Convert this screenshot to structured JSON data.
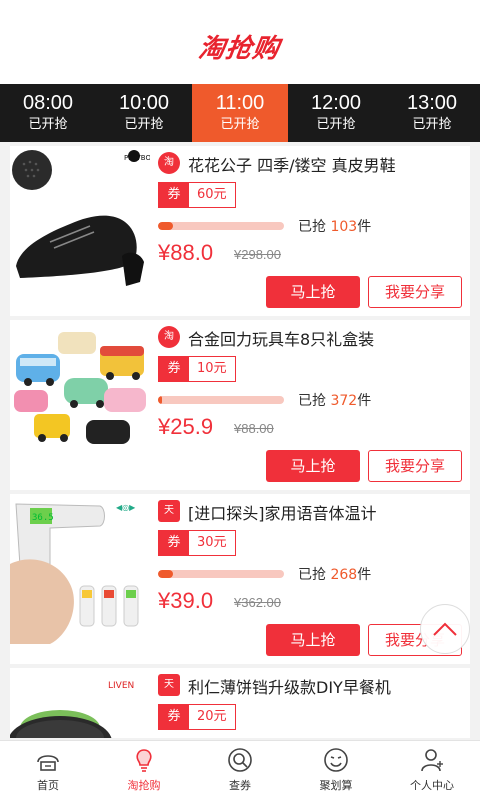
{
  "header": {
    "logo_text": "淘抢购"
  },
  "time_slots": [
    {
      "time": "08:00",
      "status": "已开抢",
      "active": false
    },
    {
      "time": "10:00",
      "status": "已开抢",
      "active": false
    },
    {
      "time": "11:00",
      "status": "已开抢",
      "active": true
    },
    {
      "time": "12:00",
      "status": "已开抢",
      "active": false
    },
    {
      "time": "13:00",
      "status": "已开抢",
      "active": false
    }
  ],
  "products": [
    {
      "source_icon": "taobao-icon",
      "title": "花花公子 四季/镂空 真皮男鞋",
      "coupon_label": "券",
      "coupon_value": "60元",
      "progress": 0.12,
      "sold_label": "已抢",
      "sold_count": "103",
      "sold_unit": "件",
      "price": "¥88.0",
      "original_price": "¥298.00",
      "buy_label": "马上抢",
      "share_label": "我要分享"
    },
    {
      "source_icon": "taobao-icon",
      "title": "合金回力玩具车8只礼盒装",
      "coupon_label": "券",
      "coupon_value": "10元",
      "progress": 0.03,
      "sold_label": "已抢",
      "sold_count": "372",
      "sold_unit": "件",
      "price": "¥25.9",
      "original_price": "¥88.00",
      "buy_label": "马上抢",
      "share_label": "我要分享"
    },
    {
      "source_icon": "tmall-icon",
      "title": "[进口探头]家用语音体温计",
      "coupon_label": "券",
      "coupon_value": "30元",
      "progress": 0.12,
      "sold_label": "已抢",
      "sold_count": "268",
      "sold_unit": "件",
      "price": "¥39.0",
      "original_price": "¥362.00",
      "buy_label": "马上抢",
      "share_label": "我要分享"
    },
    {
      "source_icon": "tmall-icon",
      "title": "利仁薄饼铛升级款DIY早餐机",
      "coupon_label": "券",
      "coupon_value": "20元"
    }
  ],
  "tabs": [
    {
      "label": "首页",
      "icon": "home-icon",
      "active": false
    },
    {
      "label": "淘抢购",
      "icon": "lightbulb-icon",
      "active": true
    },
    {
      "label": "查券",
      "icon": "coupon-search-icon",
      "active": false
    },
    {
      "label": "聚划算",
      "icon": "smiley-icon",
      "active": false
    },
    {
      "label": "个人中心",
      "icon": "user-icon",
      "active": false
    }
  ],
  "colors": {
    "brand": "#f0303a",
    "accent": "#ef5a2c",
    "timebar_bg": "#1a1a1a"
  }
}
